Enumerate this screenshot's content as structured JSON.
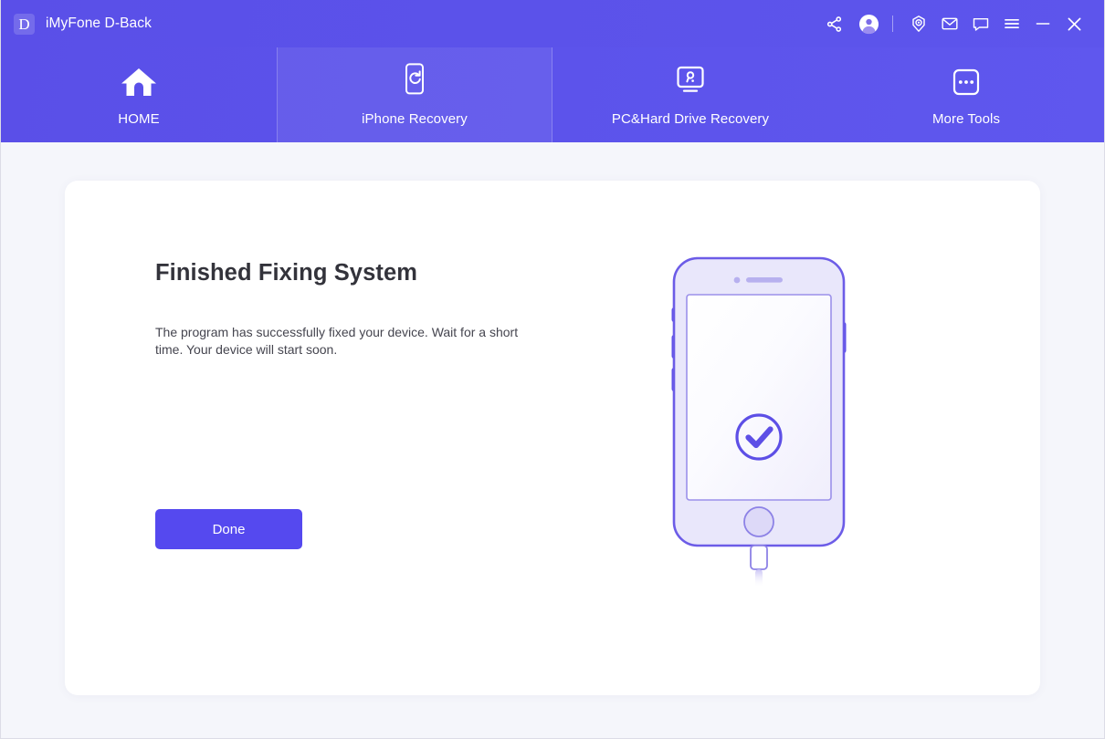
{
  "app": {
    "brand_mark": "D",
    "title": "iMyFone D-Back"
  },
  "titlebar": {
    "actions": [
      {
        "name": "share-icon",
        "label": "Share"
      },
      {
        "name": "account-avatar-icon",
        "label": "Account"
      },
      {
        "name": "support-icon",
        "label": "Support"
      },
      {
        "name": "mail-icon",
        "label": "Email"
      },
      {
        "name": "chat-icon",
        "label": "Feedback"
      },
      {
        "name": "menu-icon",
        "label": "Menu"
      },
      {
        "name": "minimize-icon",
        "label": "Minimize"
      },
      {
        "name": "close-icon",
        "label": "Close"
      }
    ]
  },
  "nav": {
    "tabs": [
      {
        "label": "HOME",
        "icon": "home-icon",
        "active": false
      },
      {
        "label": "iPhone Recovery",
        "icon": "phone-refresh-icon",
        "active": true
      },
      {
        "label": "PC&Hard Drive Recovery",
        "icon": "monitor-search-icon",
        "active": false
      },
      {
        "label": "More Tools",
        "icon": "more-dots-icon",
        "active": false
      }
    ]
  },
  "main": {
    "heading": "Finished Fixing System",
    "description": "The program has successfully fixed your device. Wait for a short time. Your device will start soon.",
    "done_label": "Done",
    "illustration": {
      "name": "iphone-with-success-check",
      "status_icon": "check-circle-icon"
    }
  },
  "colors": {
    "brand_purple": "#5549ef",
    "header_gradient_start": "#5a4fe8",
    "header_gradient_end": "#5f57ee",
    "page_background": "#f5f6fb",
    "card_background": "#ffffff",
    "heading_text": "#33333b",
    "body_text": "#45454f",
    "phone_body": "#e8e7fb",
    "phone_outline": "#6c5ce7"
  }
}
